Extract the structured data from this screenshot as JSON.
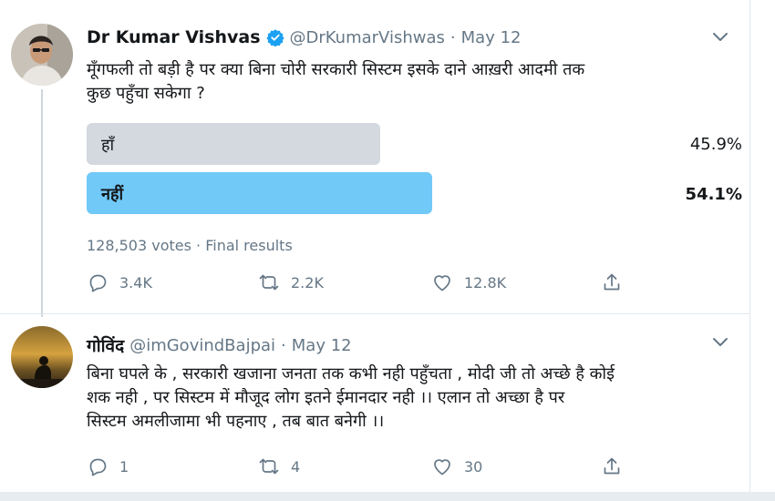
{
  "tweets": [
    {
      "name": "Dr Kumar Vishvas",
      "verified": true,
      "handle": "@DrKumarVishwas",
      "separator": "·",
      "date": "May 12",
      "text_line1": "मूँगफली तो बड़ी है पर क्या बिना चोरी सरकारी सिस्टम इसके दाने आख़री आदमी तक",
      "text_line2": "कुछ पहुँचा सकेगा ?",
      "poll": {
        "options": [
          {
            "label": "हाँ",
            "percent": "45.9%",
            "fill": 0.459
          },
          {
            "label": "नहीं",
            "percent": "54.1%",
            "fill": 0.541,
            "winner": true
          }
        ],
        "meta": "128,503 votes · Final results"
      },
      "actions": {
        "replies": "3.4K",
        "retweets": "2.2K",
        "likes": "12.8K"
      }
    },
    {
      "name": "गोविंद",
      "handle": "@imGovindBajpai",
      "separator": "·",
      "date": "May 12",
      "text_line1": "बिना घपले के , सरकारी खजाना जनता तक कभी नही पहुँचता , मोदी जी तो  अच्छे है कोई",
      "text_line2": "शक नही , पर सिस्टम में मौजूद लोग इतने ईमानदार नही ।।   एलान तो अच्छा है पर",
      "text_line3": "सिस्टम अमलीजामा भी पहनाए , तब बात बनेगी ।।",
      "actions": {
        "replies": "1",
        "retweets": "4",
        "likes": "30"
      }
    }
  ],
  "colors": {
    "poll_leading": "#71c9f8",
    "poll_other": "#d3d9de",
    "secondary_text": "#657786",
    "verified_badge": "#1da1f2"
  },
  "icons": [
    "verified-icon",
    "chevron-down-icon",
    "reply-icon",
    "retweet-icon",
    "like-icon",
    "share-icon"
  ]
}
